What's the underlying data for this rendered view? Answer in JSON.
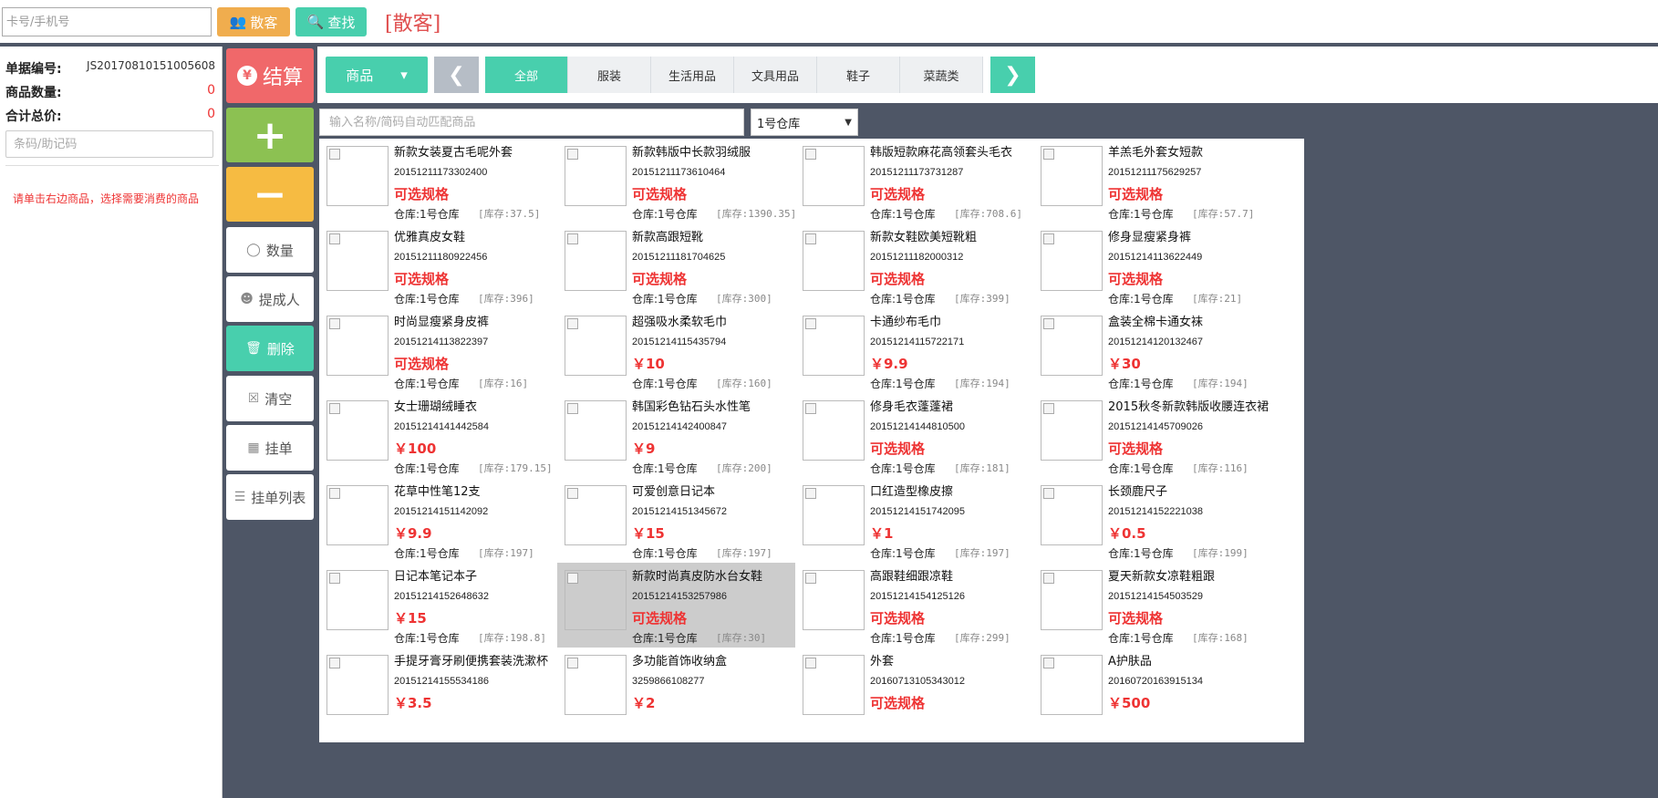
{
  "topbar": {
    "card_placeholder": "卡号/手机号",
    "guest_btn": "散客",
    "find_btn": "查找",
    "guest_tag": "[散客]"
  },
  "left": {
    "order_label": "单据编号:",
    "order_value": "JS20170810151005608",
    "count_label": "商品数量:",
    "count_value": "0",
    "total_label": "合计总价:",
    "total_value": "0",
    "barcode_placeholder": "条码/助记码",
    "hint": "请单击右边商品，选择需要消费的商品"
  },
  "actions": {
    "settle": "结算",
    "plus": "+",
    "minus": "−",
    "qty": "数量",
    "person": "提成人",
    "delete": "删除",
    "clear": "清空",
    "hold": "挂单",
    "holdlist": "挂单列表"
  },
  "filter": {
    "category": "商品",
    "tabs": [
      "全部",
      "服装",
      "生活用品",
      "文具用品",
      "鞋子",
      "菜蔬类"
    ],
    "active_tab": "全部",
    "search_placeholder": "输入名称/简码自动匹配商品",
    "warehouse": "1号仓库"
  },
  "products": [
    {
      "name": "新款女装夏古毛呢外套",
      "code": "20151211173302400",
      "price": "可选规格",
      "warehouse": "仓库:1号仓库",
      "stock": "[库存:37.5]"
    },
    {
      "name": "新款韩版中长款羽绒服",
      "code": "20151211173610464",
      "price": "可选规格",
      "warehouse": "仓库:1号仓库",
      "stock": "[库存:1390.35]"
    },
    {
      "name": "韩版短款麻花高领套头毛衣",
      "code": "20151211173731287",
      "price": "可选规格",
      "warehouse": "仓库:1号仓库",
      "stock": "[库存:708.6]"
    },
    {
      "name": "羊羔毛外套女短款",
      "code": "20151211175629257",
      "price": "可选规格",
      "warehouse": "仓库:1号仓库",
      "stock": "[库存:57.7]"
    },
    {
      "name": "优雅真皮女鞋",
      "code": "20151211180922456",
      "price": "可选规格",
      "warehouse": "仓库:1号仓库",
      "stock": "[库存:396]"
    },
    {
      "name": "新款高跟短靴",
      "code": "20151211181704625",
      "price": "可选规格",
      "warehouse": "仓库:1号仓库",
      "stock": "[库存:300]"
    },
    {
      "name": "新款女鞋欧美短靴粗",
      "code": "20151211182000312",
      "price": "可选规格",
      "warehouse": "仓库:1号仓库",
      "stock": "[库存:399]"
    },
    {
      "name": "修身显瘦紧身裤",
      "code": "20151214113622449",
      "price": "可选规格",
      "warehouse": "仓库:1号仓库",
      "stock": "[库存:21]"
    },
    {
      "name": "时尚显瘦紧身皮裤",
      "code": "20151214113822397",
      "price": "可选规格",
      "warehouse": "仓库:1号仓库",
      "stock": "[库存:16]"
    },
    {
      "name": "超强吸水柔软毛巾",
      "code": "20151214115435794",
      "price": "￥10",
      "warehouse": "仓库:1号仓库",
      "stock": "[库存:160]"
    },
    {
      "name": "卡通纱布毛巾",
      "code": "20151214115722171",
      "price": "￥9.9",
      "warehouse": "仓库:1号仓库",
      "stock": "[库存:194]"
    },
    {
      "name": "盒装全棉卡通女袜",
      "code": "20151214120132467",
      "price": "￥30",
      "warehouse": "仓库:1号仓库",
      "stock": "[库存:194]"
    },
    {
      "name": "女士珊瑚绒睡衣",
      "code": "20151214141442584",
      "price": "￥100",
      "warehouse": "仓库:1号仓库",
      "stock": "[库存:179.15]"
    },
    {
      "name": "韩国彩色钻石头水性笔",
      "code": "20151214142400847",
      "price": "￥9",
      "warehouse": "仓库:1号仓库",
      "stock": "[库存:200]"
    },
    {
      "name": "修身毛衣蓬蓬裙",
      "code": "20151214144810500",
      "price": "可选规格",
      "warehouse": "仓库:1号仓库",
      "stock": "[库存:181]"
    },
    {
      "name": "2015秋冬新款韩版收腰连衣裙",
      "code": "20151214145709026",
      "price": "可选规格",
      "warehouse": "仓库:1号仓库",
      "stock": "[库存:116]"
    },
    {
      "name": "花草中性笔12支",
      "code": "20151214151142092",
      "price": "￥9.9",
      "warehouse": "仓库:1号仓库",
      "stock": "[库存:197]"
    },
    {
      "name": "可爱创意日记本",
      "code": "20151214151345672",
      "price": "￥15",
      "warehouse": "仓库:1号仓库",
      "stock": "[库存:197]"
    },
    {
      "name": "口红造型橡皮擦",
      "code": "20151214151742095",
      "price": "￥1",
      "warehouse": "仓库:1号仓库",
      "stock": "[库存:197]"
    },
    {
      "name": "长颈鹿尺子",
      "code": "20151214152221038",
      "price": "￥0.5",
      "warehouse": "仓库:1号仓库",
      "stock": "[库存:199]"
    },
    {
      "name": "日记本笔记本子",
      "code": "20151214152648632",
      "price": "￥15",
      "warehouse": "仓库:1号仓库",
      "stock": "[库存:198.8]"
    },
    {
      "name": "新款时尚真皮防水台女鞋",
      "code": "20151214153257986",
      "price": "可选规格",
      "warehouse": "仓库:1号仓库",
      "stock": "[库存:30]"
    },
    {
      "name": "高跟鞋细跟凉鞋",
      "code": "20151214154125126",
      "price": "可选规格",
      "warehouse": "仓库:1号仓库",
      "stock": "[库存:299]"
    },
    {
      "name": "夏天新款女凉鞋粗跟",
      "code": "20151214154503529",
      "price": "可选规格",
      "warehouse": "仓库:1号仓库",
      "stock": "[库存:168]"
    },
    {
      "name": "手提牙膏牙刷便携套装洗漱杯",
      "code": "20151214155534186",
      "price": "￥3.5",
      "warehouse": "",
      "stock": ""
    },
    {
      "name": "多功能首饰收纳盒",
      "code": "3259866108277",
      "price": "￥2",
      "warehouse": "",
      "stock": ""
    },
    {
      "name": "外套",
      "code": "20160713105343012",
      "price": "可选规格",
      "warehouse": "",
      "stock": ""
    },
    {
      "name": "A护肤品",
      "code": "20160720163915134",
      "price": "￥500",
      "warehouse": "",
      "stock": ""
    }
  ],
  "selected_index": 21
}
